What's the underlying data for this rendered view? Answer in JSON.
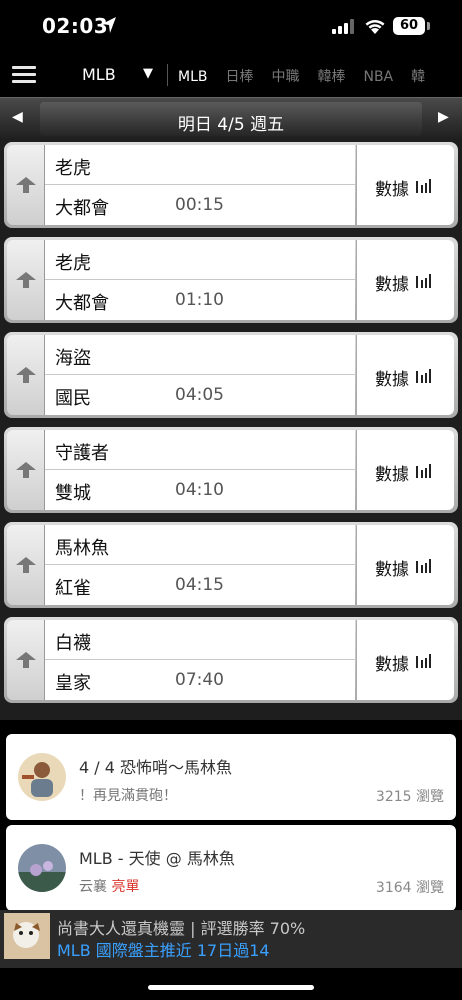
{
  "status": {
    "time": "02:03",
    "battery": "60"
  },
  "nav": {
    "league": "MLB",
    "tabs": [
      "MLB",
      "日棒",
      "中職",
      "韓棒",
      "NBA",
      "韓"
    ]
  },
  "datebar": {
    "label": "明日 4/5 週五"
  },
  "games": [
    {
      "away": "老虎",
      "home": "大都會",
      "time": "00:15",
      "stats": "數據"
    },
    {
      "away": "老虎",
      "home": "大都會",
      "time": "01:10",
      "stats": "數據"
    },
    {
      "away": "海盜",
      "home": "國民",
      "time": "04:05",
      "stats": "數據"
    },
    {
      "away": "守護者",
      "home": "雙城",
      "time": "04:10",
      "stats": "數據"
    },
    {
      "away": "馬林魚",
      "home": "紅雀",
      "time": "04:15",
      "stats": "數據"
    },
    {
      "away": "白襪",
      "home": "皇家",
      "time": "07:40",
      "stats": "數據"
    }
  ],
  "posts": [
    {
      "title": "4 / 4  恐怖哨～馬林魚",
      "sub": "！再見滿貫砲！",
      "badge": "",
      "views": "3215 瀏覽"
    },
    {
      "title": "MLB - 天使 @ 馬林魚",
      "sub": "云襄 ",
      "badge": "亮單",
      "views": "3164 瀏覽"
    }
  ],
  "ad": {
    "line1": "尚書大人還真機靈 | 評選勝率 70%",
    "line2": "MLB 國際盤主推近 17日過14"
  },
  "colors": {
    "accent": "#3aa0ff",
    "badge": "#d9342b"
  }
}
